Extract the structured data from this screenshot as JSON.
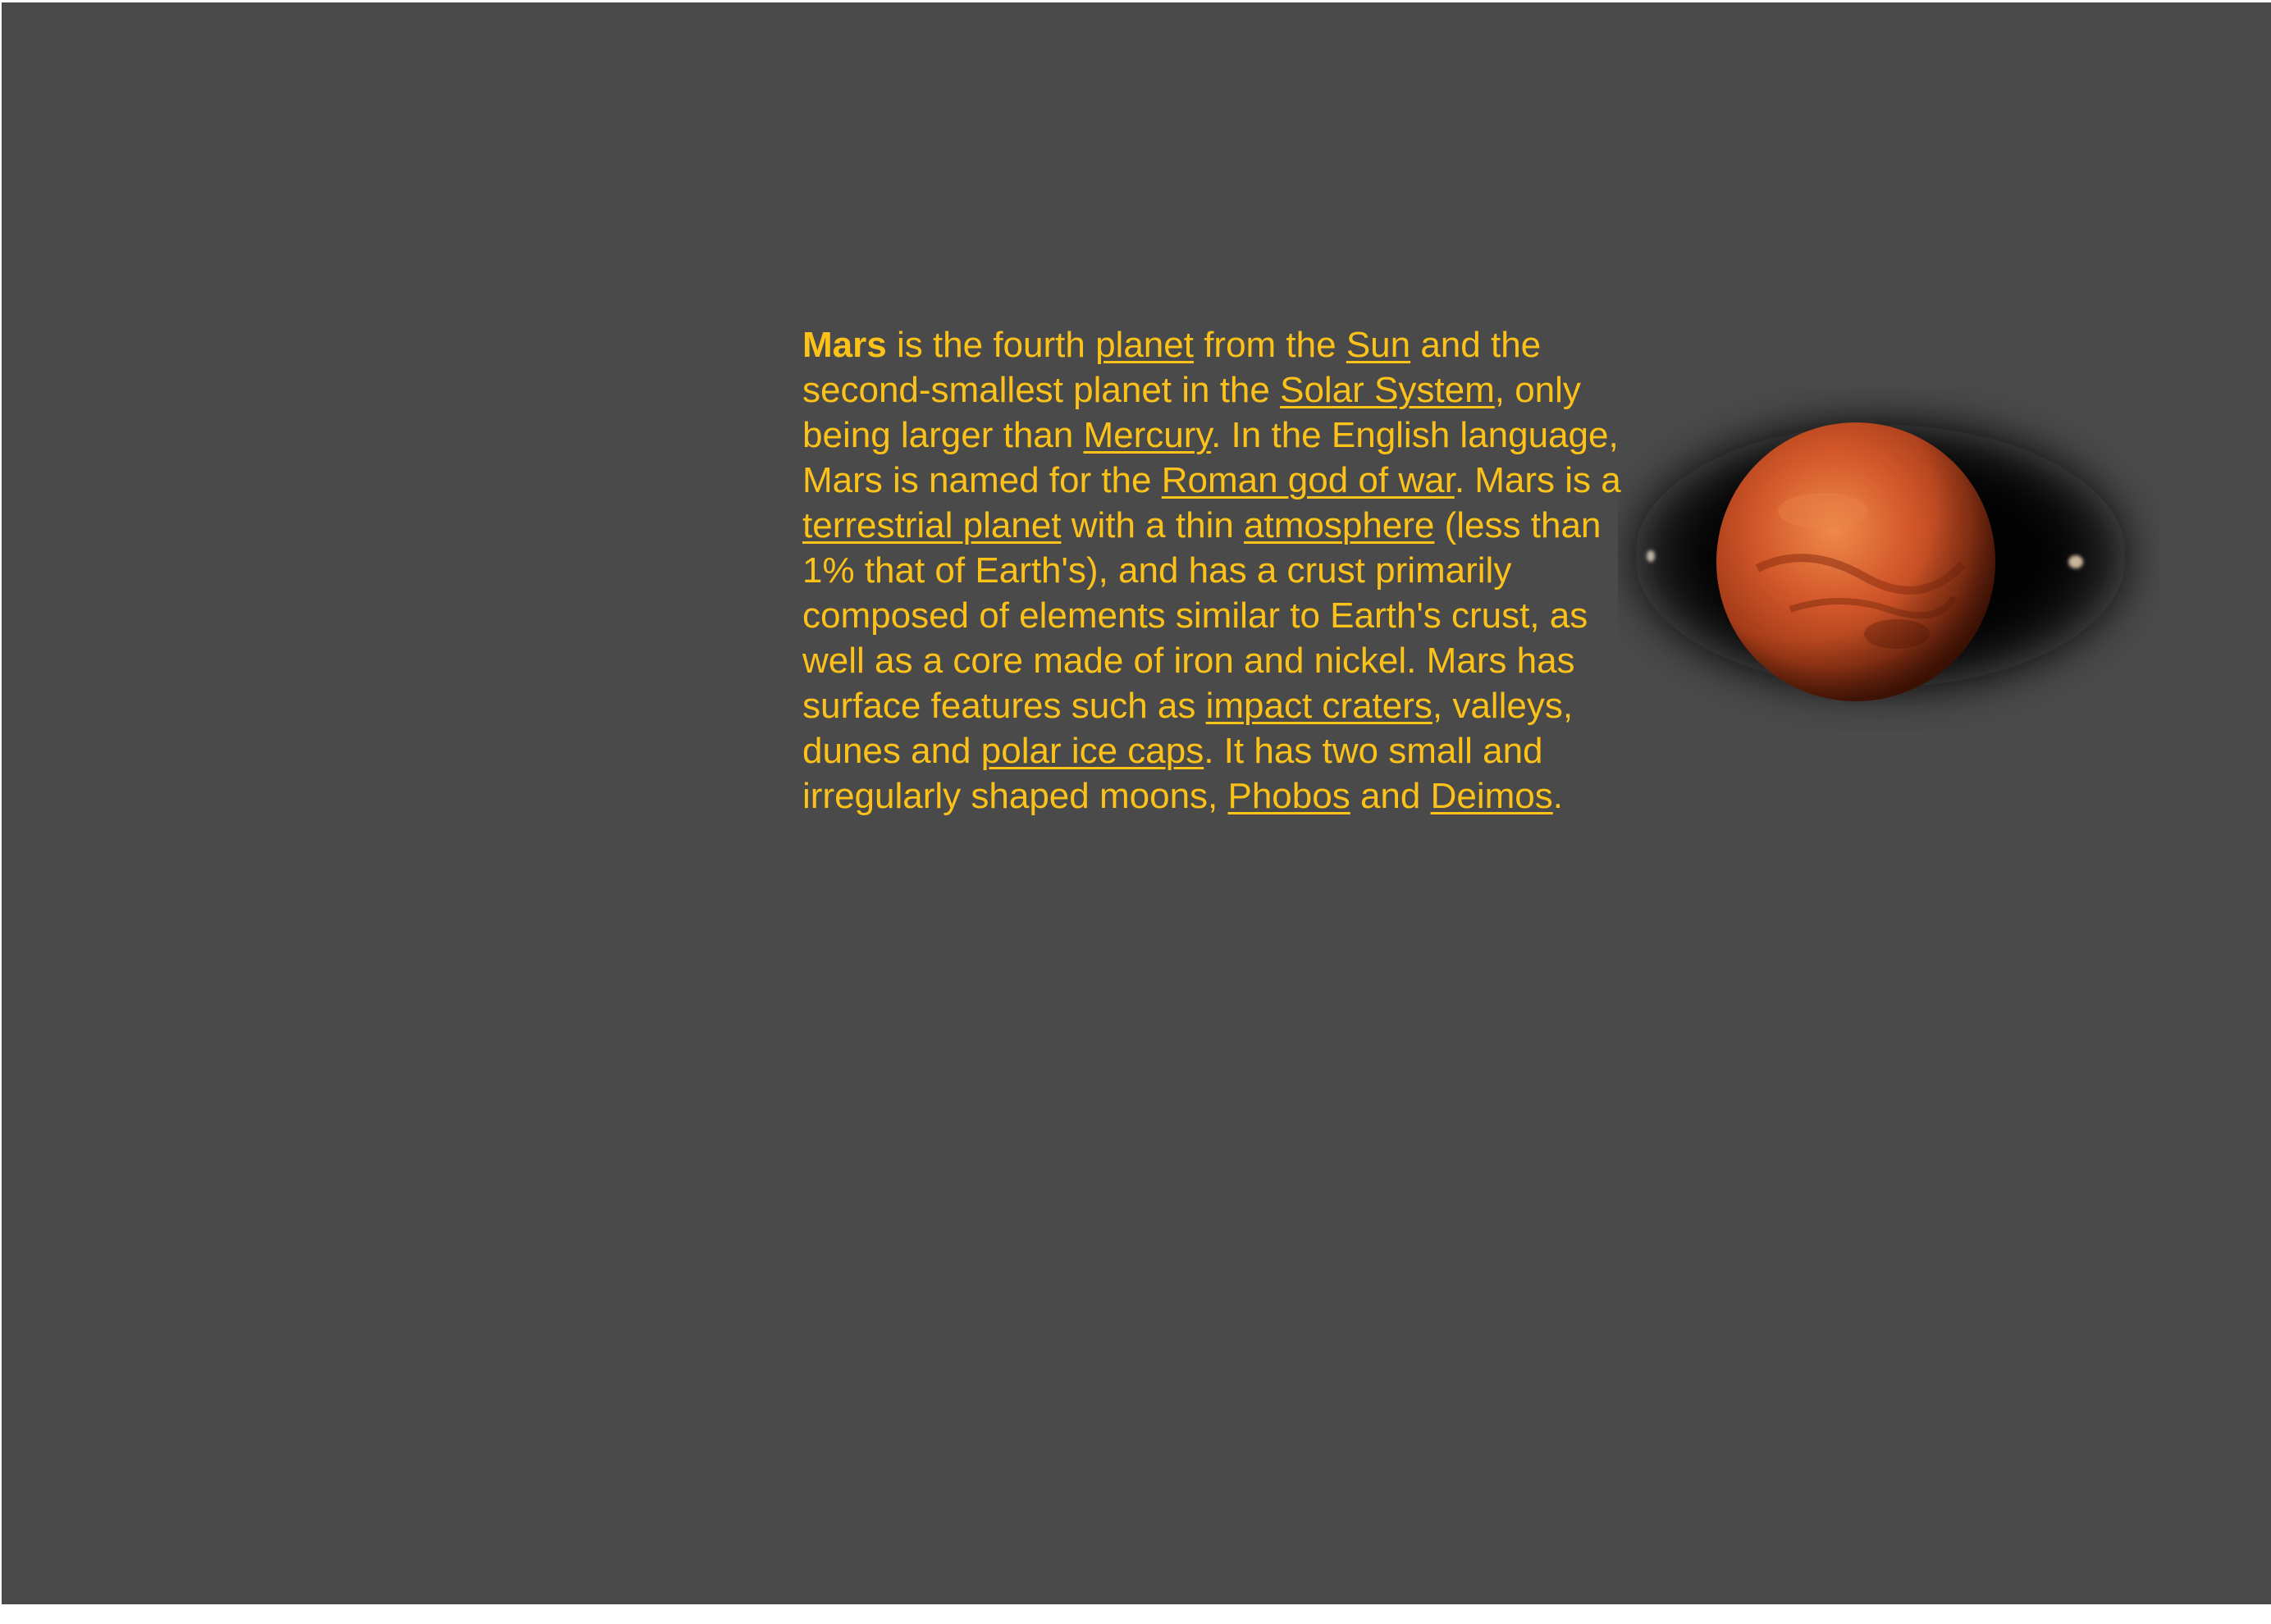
{
  "article": {
    "subject": "Mars",
    "t1": " is the fourth ",
    "link_planet": "planet",
    "t2": " from the ",
    "link_sun": "Sun",
    "t3": " and the second-smallest planet in the ",
    "link_solar_system": "Solar System",
    "t4": ", only being larger than ",
    "link_mercury": "Mercury",
    "t5": ". In the English language, Mars is named for the ",
    "link_roman_god": "Roman god of war",
    "t6": ". Mars is a ",
    "link_terrestrial_planet": "terrestrial planet",
    "t7": " with a thin ",
    "link_atmosphere": "atmosphere",
    "t8": " (less than 1% that of Earth's), and has a crust primarily composed of elements similar to Earth's crust, as well as a core made of iron and nickel. Mars has surface features such as ",
    "link_impact_craters": "impact craters",
    "t9": ", valleys, dunes and ",
    "link_polar_ice_caps": "polar ice caps",
    "t10": ". It has two small and irregularly shaped moons, ",
    "link_phobos": "Phobos",
    "t11": " and ",
    "link_deimos": "Deimos",
    "t12": "."
  },
  "colors": {
    "background": "#4a4a4a",
    "text": "#fcc21a",
    "mars_surface": "#d2572a"
  },
  "image": {
    "icon": "mars-planet-with-moons"
  }
}
